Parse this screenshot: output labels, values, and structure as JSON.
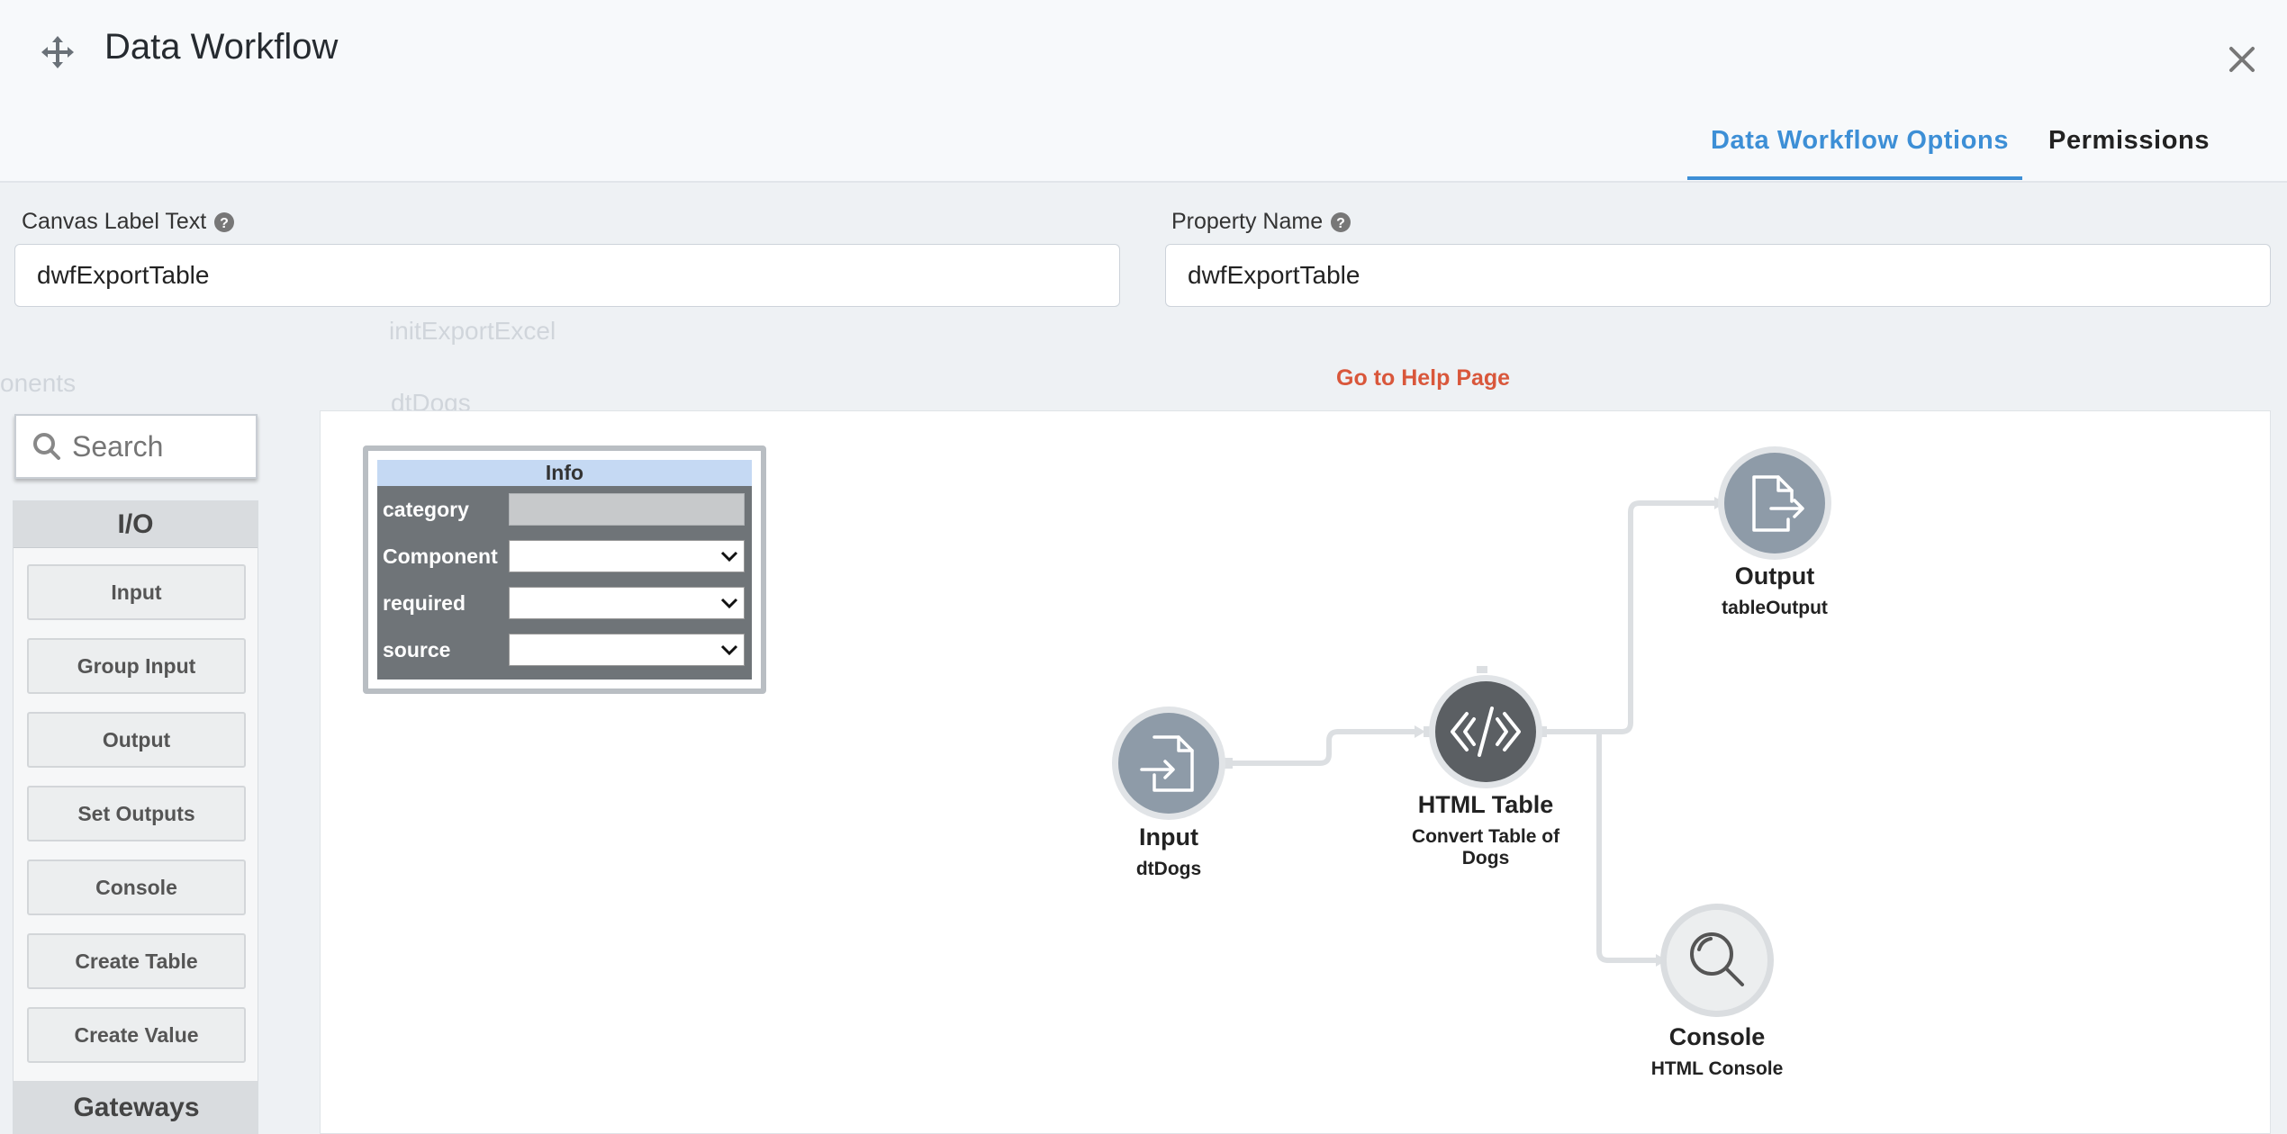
{
  "header": {
    "title": "Data Workflow",
    "tabs": [
      {
        "label": "Data Workflow Options",
        "active": true
      },
      {
        "label": "Permissions",
        "active": false
      }
    ]
  },
  "fields": {
    "canvas_label": {
      "label": "Canvas Label Text",
      "value": "dwfExportTable"
    },
    "property_name": {
      "label": "Property Name",
      "value": "dwfExportTable"
    }
  },
  "help_link": "Go to Help Page",
  "background_remnants": {
    "workflow_item": "initExportExcel",
    "data_item": "dtDogs",
    "sidebar_text": "onents"
  },
  "palette": {
    "search_placeholder": "Search",
    "section_io": "I/O",
    "items": [
      "Input",
      "Group Input",
      "Output",
      "Set Outputs",
      "Console",
      "Create Table",
      "Create Value"
    ],
    "section_gateways": "Gateways"
  },
  "info_panel": {
    "title": "Info",
    "rows": [
      {
        "label": "category",
        "value": ""
      },
      {
        "label": "Component",
        "value": ""
      },
      {
        "label": "required",
        "value": ""
      },
      {
        "label": "source",
        "value": ""
      }
    ]
  },
  "nodes": {
    "input": {
      "title": "Input",
      "subtitle": "dtDogs"
    },
    "html_table": {
      "title": "HTML Table",
      "subtitle": "Convert Table of Dogs"
    },
    "output": {
      "title": "Output",
      "subtitle": "tableOutput"
    },
    "console": {
      "title": "Console",
      "subtitle": "HTML Console"
    }
  },
  "colors": {
    "accent": "#3d8fd6",
    "help_link": "#d9573b",
    "node_gray": "#8e9ba8",
    "node_dark": "#555a5f",
    "info_header": "#c5d9f3"
  }
}
